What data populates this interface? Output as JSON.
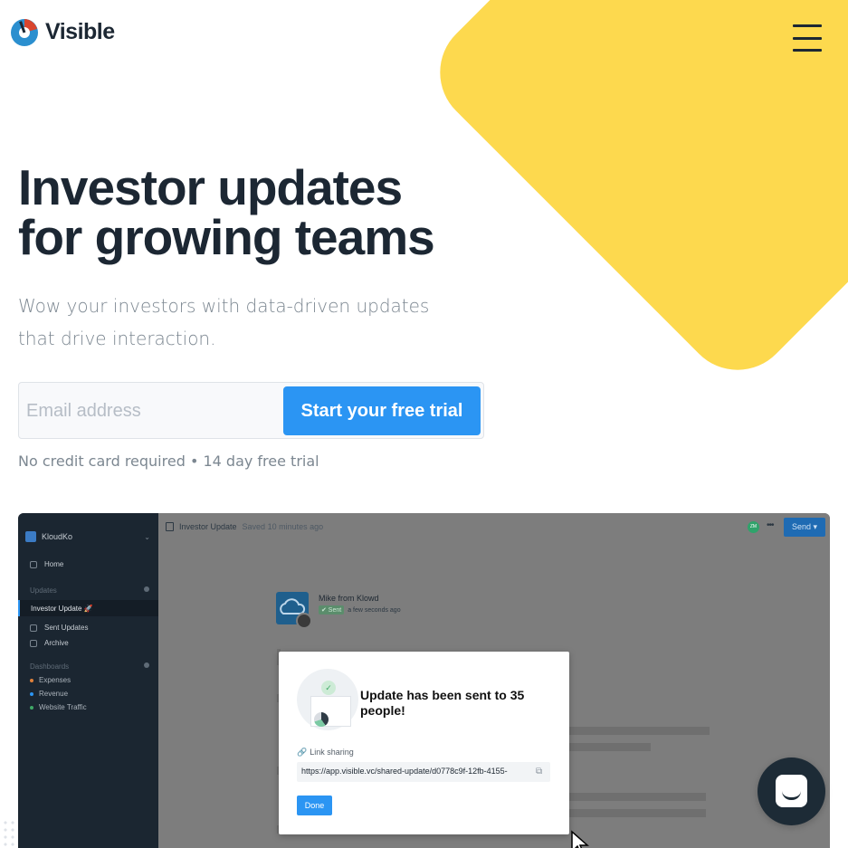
{
  "brand": {
    "name": "Visible",
    "accent": "#2b95f3",
    "highlight": "#fdd94e",
    "text_dark": "#1c2733"
  },
  "header": {
    "logo_icon": "visible-logo-icon",
    "menu_icon": "hamburger-menu-icon"
  },
  "hero": {
    "headline_line1": "Investor updates",
    "headline_line2": "for growing teams",
    "subhead": "Wow your investors with data-driven updates that drive interaction.",
    "email_placeholder": "Email address",
    "cta_label": "Start your free trial",
    "fine_print": "No credit card required • 14 day free trial"
  },
  "app_preview": {
    "sidebar": {
      "org_name": "KloudKo",
      "home_label": "Home",
      "updates_section": "Updates",
      "active_item": "Investor Update 🚀",
      "sent_updates": "Sent Updates",
      "archive": "Archive",
      "dashboards_section": "Dashboards",
      "dashboards": [
        {
          "label": "Expenses",
          "color": "#e0813a"
        },
        {
          "label": "Revenue",
          "color": "#2b95f3"
        },
        {
          "label": "Website Traffic",
          "color": "#3fa866"
        }
      ]
    },
    "topbar": {
      "doc_title": "Investor Update",
      "saved_status": "Saved 10 minutes ago",
      "avatar_initials": "ZM",
      "more_icon": "more-horizontal-icon",
      "send_label": "Send ▾"
    },
    "sender": {
      "name": "Mike from Klowd",
      "status_badge": "✔ Sent",
      "status_time": "a few seconds ago"
    },
    "modal": {
      "title": "Update has been sent to 35 people!",
      "link_label": "Link sharing",
      "link_icon": "link-icon",
      "link_value": "https://app.visible.vc/shared-update/d0778c9f-12fb-4155-",
      "copy_icon": "copy-icon",
      "done_label": "Done"
    }
  },
  "chat": {
    "icon": "chat-bubble-icon"
  }
}
